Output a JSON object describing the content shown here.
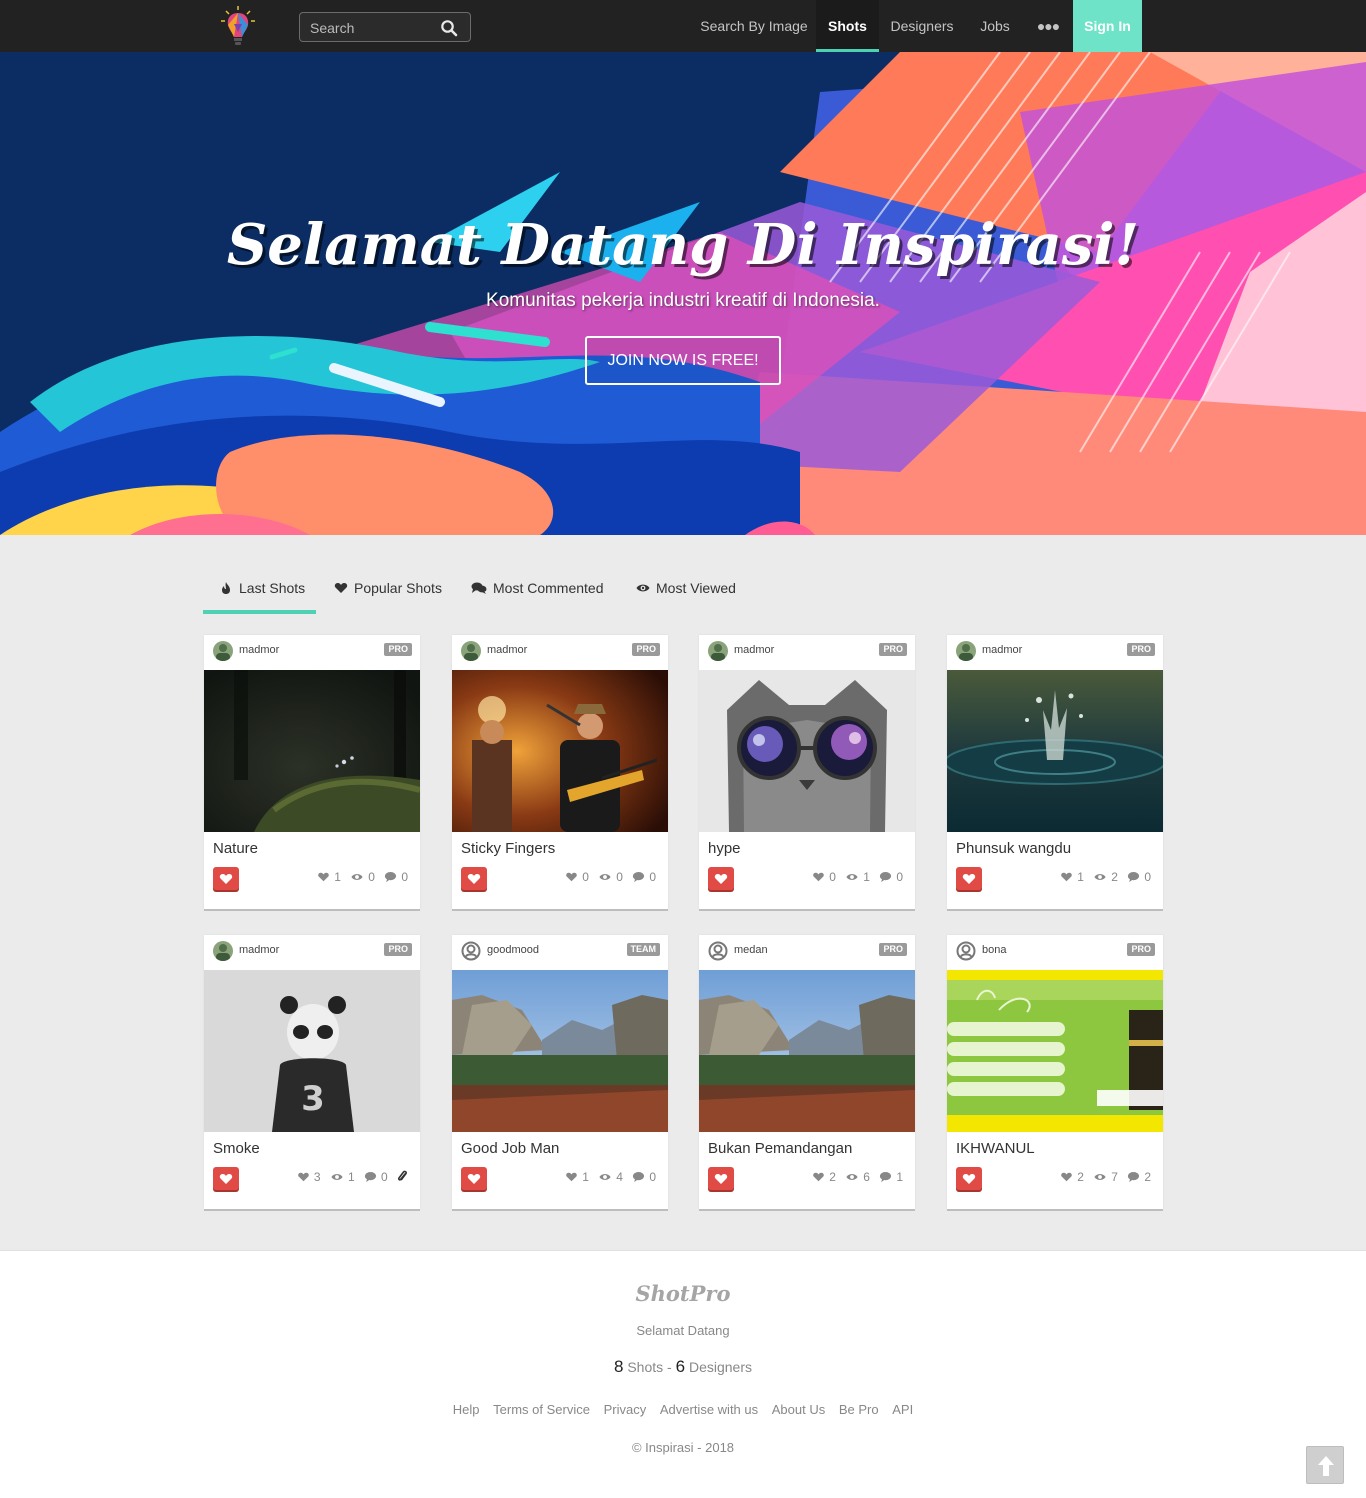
{
  "nav": {
    "search_placeholder": "Search",
    "links": [
      "Search By Image",
      "Shots",
      "Designers",
      "Jobs"
    ],
    "more": "●●●",
    "sign_in": "Sign In",
    "active": "Shots"
  },
  "hero": {
    "title": "Selamat Datang Di Inspirasi!",
    "subtitle": "Komunitas pekerja industri kreatif di Indonesia.",
    "cta": "JOIN NOW IS FREE!"
  },
  "tabs": [
    {
      "label": "Last Shots",
      "icon": "fire-icon"
    },
    {
      "label": "Popular Shots",
      "icon": "heart-icon"
    },
    {
      "label": "Most Commented",
      "icon": "comments-icon"
    },
    {
      "label": "Most Viewed",
      "icon": "eye-icon"
    }
  ],
  "shots": [
    {
      "user": "madmor",
      "badge": "PRO",
      "title": "Nature",
      "likes": "1",
      "views": "0",
      "comments": "0"
    },
    {
      "user": "madmor",
      "badge": "PRO",
      "title": "Sticky Fingers",
      "likes": "0",
      "views": "0",
      "comments": "0"
    },
    {
      "user": "madmor",
      "badge": "PRO",
      "title": "hype",
      "likes": "0",
      "views": "1",
      "comments": "0"
    },
    {
      "user": "madmor",
      "badge": "PRO",
      "title": "Phunsuk wangdu",
      "likes": "1",
      "views": "2",
      "comments": "0"
    },
    {
      "user": "madmor",
      "badge": "PRO",
      "title": "Smoke",
      "likes": "3",
      "views": "1",
      "comments": "0",
      "attachment": true
    },
    {
      "user": "goodmood",
      "badge": "TEAM",
      "title": "Good Job Man",
      "likes": "1",
      "views": "4",
      "comments": "0"
    },
    {
      "user": "medan",
      "badge": "PRO",
      "title": "Bukan Pemandangan",
      "likes": "2",
      "views": "6",
      "comments": "1"
    },
    {
      "user": "bona",
      "badge": "PRO",
      "title": "IKHWANUL",
      "likes": "2",
      "views": "7",
      "comments": "2"
    }
  ],
  "footer": {
    "brand": "ShotPro",
    "welcome": "Selamat Datang",
    "shots_count": "8",
    "shots_label": "Shots",
    "separator": "-",
    "designers_count": "6",
    "designers_label": "Designers",
    "links": [
      "Help",
      "Terms of Service",
      "Privacy",
      "Advertise with us",
      "About Us",
      "Be Pro",
      "API"
    ],
    "copyright": "© Inspirasi - 2018"
  },
  "colors": {
    "accent": "#4fd1b4",
    "header_bg": "#222222",
    "like_red": "#e04b45"
  }
}
